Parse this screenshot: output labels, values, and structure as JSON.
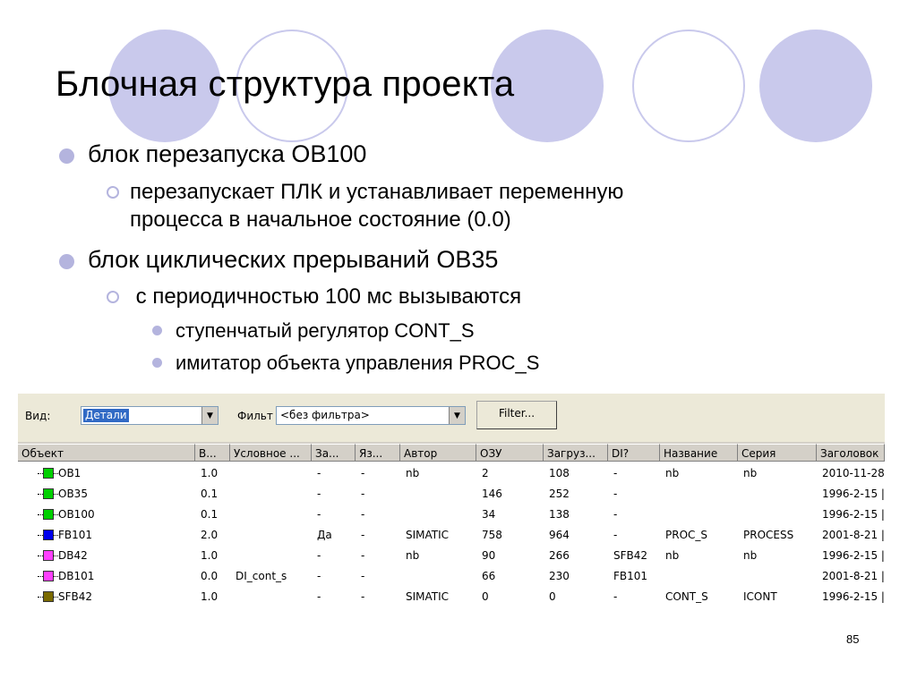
{
  "slide": {
    "title": "Блочная структура проекта",
    "bullets": [
      {
        "level": 1,
        "text": "блок перезапуска OB100"
      },
      {
        "level": 2,
        "text": "перезапускает ПЛК и устанавливает переменную"
      },
      {
        "level": 2,
        "text": "процесса в начальное состояние (0.0)",
        "continuation": true
      },
      {
        "level": 1,
        "text": "блок циклических прерываний OB35"
      },
      {
        "level": 2,
        "text": " с периодичностью 100 мс вызываются"
      },
      {
        "level": 3,
        "text": "ступенчатый регулятор CONT_S"
      },
      {
        "level": 3,
        "text": "имитатор объекта управления PROC_S"
      }
    ],
    "page_number": "85",
    "colors": {
      "circle": "#c9c9ec",
      "bullet": "#b4b4de"
    }
  },
  "window": {
    "view_label": "Вид:",
    "view_value": "Детали",
    "filter_label": "Фильт",
    "filter_value": "<без фильтра>",
    "filter_button": "Filter...",
    "columns": [
      "Объект",
      "В...",
      "Условное ...",
      "За...",
      "Яз...",
      "Автор",
      "ОЗУ",
      "Загруз...",
      "DI?",
      "Название",
      "Серия",
      "Заголовок"
    ],
    "rows": [
      {
        "name": "OB1",
        "icon_color": "#00d000",
        "ver": "1.0",
        "symbol": "",
        "prot": "-",
        "lang": "-",
        "author": "nb",
        "ram": "2",
        "load": "108",
        "di": "-",
        "title": "nb",
        "series": "nb",
        "header": "2010-11-28"
      },
      {
        "name": "OB35",
        "icon_color": "#00d000",
        "ver": "0.1",
        "symbol": "",
        "prot": "-",
        "lang": "-",
        "author": "",
        "ram": "146",
        "load": "252",
        "di": "-",
        "title": "",
        "series": "",
        "header": "1996-2-15 |"
      },
      {
        "name": "OB100",
        "icon_color": "#00d000",
        "ver": "0.1",
        "symbol": "",
        "prot": "-",
        "lang": "-",
        "author": "",
        "ram": "34",
        "load": "138",
        "di": "-",
        "title": "",
        "series": "",
        "header": "1996-2-15 |"
      },
      {
        "name": "FB101",
        "icon_color": "#0000ee",
        "ver": "2.0",
        "symbol": "",
        "prot": "Да",
        "lang": "-",
        "author": "SIMATIC",
        "ram": "758",
        "load": "964",
        "di": "-",
        "title": "PROC_S",
        "series": "PROCESS",
        "header": "2001-8-21 |"
      },
      {
        "name": "DB42",
        "icon_color": "#ff40ff",
        "ver": "1.0",
        "symbol": "",
        "prot": "-",
        "lang": "-",
        "author": "nb",
        "ram": "90",
        "load": "266",
        "di": "SFB42",
        "title": "nb",
        "series": "nb",
        "header": "1996-2-15 |"
      },
      {
        "name": "DB101",
        "icon_color": "#ff40ff",
        "ver": "0.0",
        "symbol": "DI_cont_s",
        "prot": "-",
        "lang": "-",
        "author": "",
        "ram": "66",
        "load": "230",
        "di": "FB101",
        "title": "",
        "series": "",
        "header": "2001-8-21 |"
      },
      {
        "name": "SFB42",
        "icon_color": "#7a6a00",
        "ver": "1.0",
        "symbol": "",
        "prot": "-",
        "lang": "-",
        "author": "SIMATIC",
        "ram": "0",
        "load": "0",
        "di": "-",
        "title": "CONT_S",
        "series": "ICONT",
        "header": "1996-2-15 |"
      }
    ]
  }
}
